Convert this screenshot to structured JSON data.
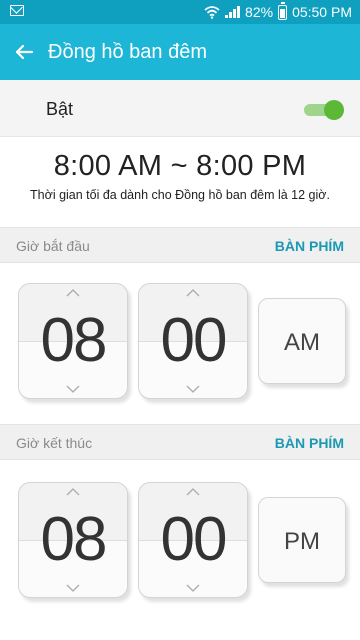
{
  "status_bar": {
    "battery": "82%",
    "time": "05:50 PM",
    "icons": [
      "mail-icon",
      "wifi-icon",
      "signal-icon",
      "battery-icon"
    ]
  },
  "app_bar": {
    "title": "Đồng hồ ban đêm",
    "back_icon": "back-arrow-icon",
    "color": "#1eb6d6"
  },
  "toggle": {
    "label": "Bật",
    "on": true,
    "accent": "#5cb837"
  },
  "summary": {
    "range": "8:00 AM ~ 8:00 PM",
    "note": "Thời gian tối đa dành cho Đồng hồ ban đêm là 12 giờ."
  },
  "start": {
    "label": "Giờ bắt đầu",
    "keyboard": "BÀN PHÍM",
    "hour": "08",
    "minute": "00",
    "period": "AM"
  },
  "end": {
    "label": "Giờ kết thúc",
    "keyboard": "BÀN PHÍM",
    "hour": "08",
    "minute": "00",
    "period": "PM"
  },
  "link_color": "#1c98b3"
}
